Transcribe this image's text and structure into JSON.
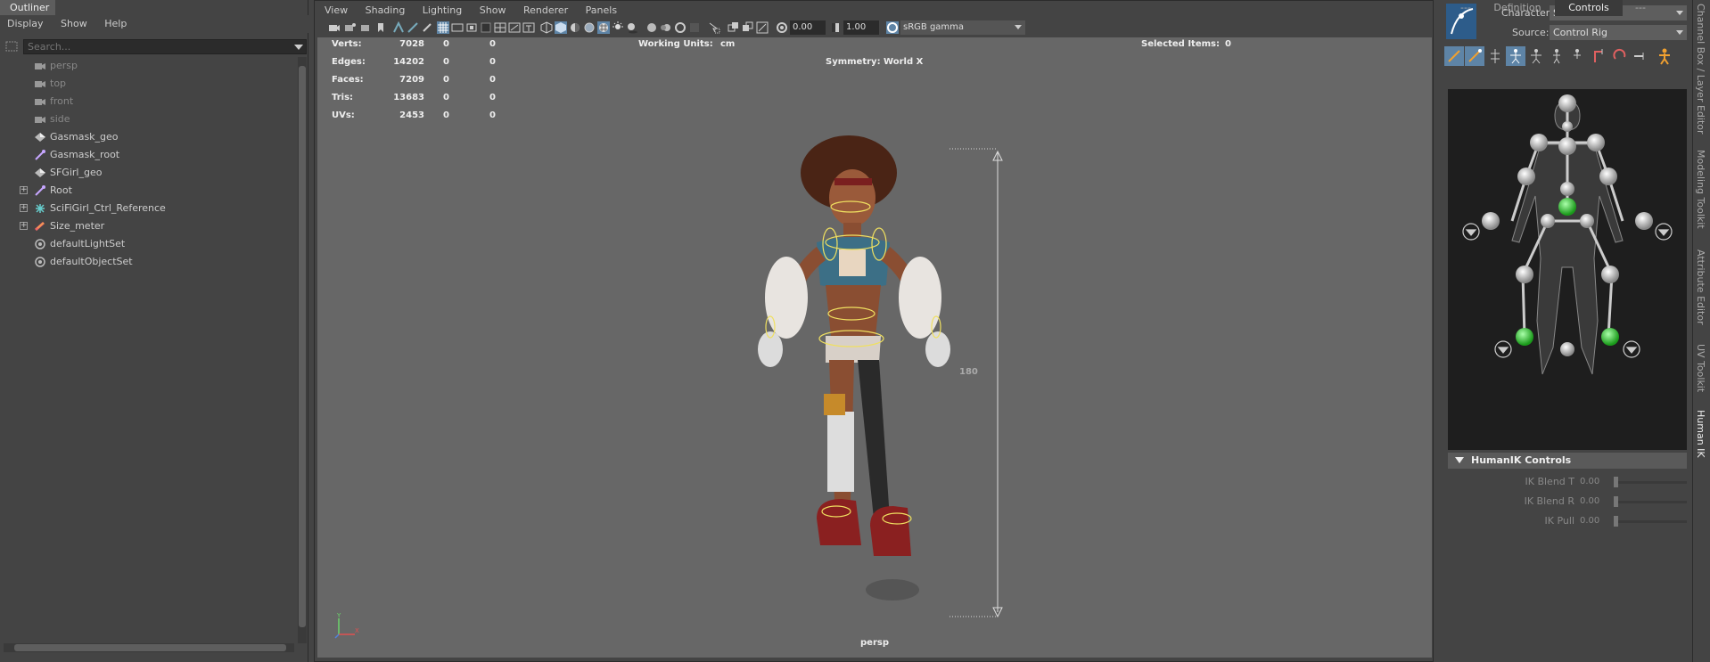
{
  "outliner": {
    "title": "Outliner",
    "menu": [
      "Display",
      "Show",
      "Help"
    ],
    "search_placeholder": "Search...",
    "items": [
      {
        "label": "persp",
        "icon": "camera-icon",
        "dim": true,
        "expandable": false
      },
      {
        "label": "top",
        "icon": "camera-icon",
        "dim": true,
        "expandable": false
      },
      {
        "label": "front",
        "icon": "camera-icon",
        "dim": true,
        "expandable": false
      },
      {
        "label": "side",
        "icon": "camera-icon",
        "dim": true,
        "expandable": false
      },
      {
        "label": "Gasmask_geo",
        "icon": "mesh-icon",
        "dim": false,
        "expandable": false
      },
      {
        "label": "Gasmask_root",
        "icon": "joint-icon",
        "dim": false,
        "expandable": false
      },
      {
        "label": "SFGirl_geo",
        "icon": "mesh-icon",
        "dim": false,
        "expandable": false
      },
      {
        "label": "Root",
        "icon": "joint-icon",
        "dim": false,
        "expandable": true
      },
      {
        "label": "SciFiGirl_Ctrl_Reference",
        "icon": "control-icon",
        "dim": false,
        "expandable": true
      },
      {
        "label": "Size_meter",
        "icon": "measure-icon",
        "dim": false,
        "expandable": true
      },
      {
        "label": "defaultLightSet",
        "icon": "set-icon",
        "dim": false,
        "expandable": false
      },
      {
        "label": "defaultObjectSet",
        "icon": "set-icon",
        "dim": false,
        "expandable": false
      }
    ]
  },
  "viewport": {
    "menu": [
      "View",
      "Shading",
      "Lighting",
      "Show",
      "Renderer",
      "Panels"
    ],
    "exposure": "0.00",
    "gamma": "1.00",
    "color_space": "sRGB gamma",
    "hud": {
      "rows": [
        {
          "label": "Verts:",
          "v1": "7028",
          "v2": "0",
          "v3": "0"
        },
        {
          "label": "Edges:",
          "v1": "14202",
          "v2": "0",
          "v3": "0"
        },
        {
          "label": "Faces:",
          "v1": "7209",
          "v2": "0",
          "v3": "0"
        },
        {
          "label": "Tris:",
          "v1": "13683",
          "v2": "0",
          "v3": "0"
        },
        {
          "label": "UVs:",
          "v1": "2453",
          "v2": "0",
          "v3": "0"
        }
      ],
      "working_units_label": "Working Units:",
      "working_units_value": "cm",
      "symmetry": "Symmetry: World X",
      "selected_label": "Selected Items:",
      "selected_value": "0",
      "measure_value": "180"
    },
    "camera": "persp",
    "axis_labels": {
      "y": "Y",
      "x": "X"
    }
  },
  "humanik": {
    "character_label": "Character:",
    "character_value": "SciFiGirl",
    "source_label": "Source:",
    "source_value": "Control Rig",
    "tabs": [
      "---",
      "Definition",
      "Controls",
      "---"
    ],
    "controls_header": "HumanIK Controls",
    "sliders": [
      {
        "label": "IK Blend T",
        "value": "0.00"
      },
      {
        "label": "IK Blend R",
        "value": "0.00"
      },
      {
        "label": "IK Pull",
        "value": "0.00"
      }
    ]
  },
  "side_tabs": [
    "Channel Box / Layer Editor",
    "Modeling Toolkit",
    "Attribute Editor",
    "UV Toolkit",
    "Human IK"
  ],
  "colors": {
    "panel_bg": "#444444",
    "viewport_bg": "#676767",
    "accent": "#5e84a6",
    "ik_effector": "#33cc33",
    "rig_curve": "#f0e060"
  }
}
